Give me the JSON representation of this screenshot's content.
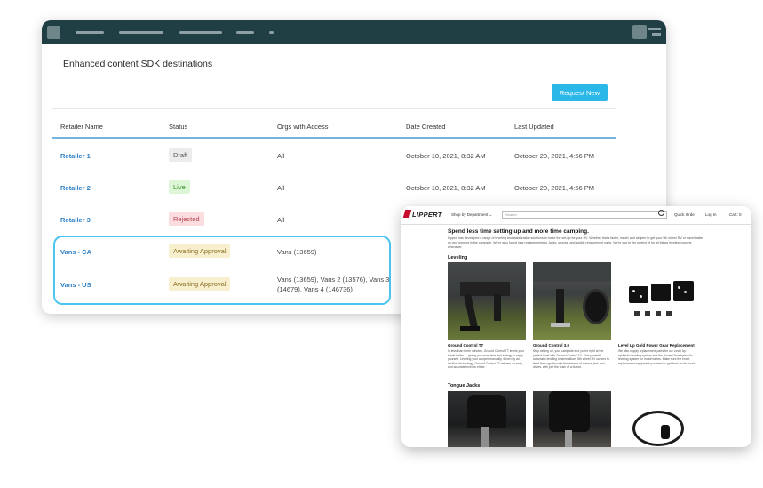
{
  "dashboard": {
    "title": "Enhanced content SDK destinations",
    "request_button": "Request New",
    "columns": [
      "Retailer Name",
      "Status",
      "Orgs with Access",
      "Date Created",
      "Last Updated"
    ],
    "rows": [
      {
        "name": "Retailer 1",
        "status": "Draft",
        "orgs": "All",
        "created": "October 10, 2021, 8:32 AM",
        "updated": "October 20, 2021, 4:56 PM"
      },
      {
        "name": "Retailer 2",
        "status": "Live",
        "orgs": "All",
        "created": "October 10, 2021, 8:32 AM",
        "updated": "October 20, 2021, 4:56 PM"
      },
      {
        "name": "Retailer 3",
        "status": "Rejected",
        "orgs": "All"
      },
      {
        "name": "Vans - CA",
        "status": "Awaiting Approval",
        "orgs": "Vans (13659)"
      },
      {
        "name": "Vans - US",
        "status": "Awaiting Approval",
        "orgs_line1": "Vans (13659), Vans 2 (13576), Vans 3",
        "orgs_line2": "(14679), Vans 4 (146736)"
      }
    ],
    "status_colors": {
      "draft": "#ececec",
      "live": "#dcf6d6",
      "rejected": "#fbdde0",
      "awaiting": "#f7efcd"
    },
    "accent": "#2bb8e8"
  },
  "lippert": {
    "logo": "LIPPERT",
    "shop": "Shop by Department ⌄",
    "search_placeholder": "Search",
    "nav_quick_order": "Quick Order",
    "nav_login": "Log In",
    "nav_cart": "Cart: 0",
    "headline": "Spend less time setting up and more time camping.",
    "intro": "Lippert has developed a range of leveling and stabilization solutions to make the set-up for your RV. Whether that's faster, easier and simpler to get your 5th wheel RV or travel trailer up and running in the campsite. We're also found new replacements to Jacks, shocks, and switch replacement parts. We're you're the perfect fit for all things leveling your rig whenever.",
    "section_leveling": "Leveling",
    "section_tongue": "Tongue Jacks",
    "products": [
      {
        "name": "Ground Control TT",
        "desc": "In less than three minutes, Ground Control TT levels your travel trailer — giving you more time and energy to enjoy yourself. Leveling your camper manually, driven by an intuitive technology, Ground Control TT delivers an easy and accurate level on either."
      },
      {
        "name": "Ground Control 3.0",
        "desc": "Stop setting up, your campsite and you're right at the perfect level with Ground Control 3.0. This powerful, automatic leveling system allows 5th wheel RV owners to level their rigs through the release of manual jack and drives, with just the push of a button."
      },
      {
        "name": "Level Up Gold Power Gear Replacement",
        "desc": "We also supply replacement parts for our Level Up hydraulic leveling system and the Power Gear hydraulic leveling system for motorhomes. Make sure the exact replacement equipment you need to get back on the road."
      }
    ]
  }
}
